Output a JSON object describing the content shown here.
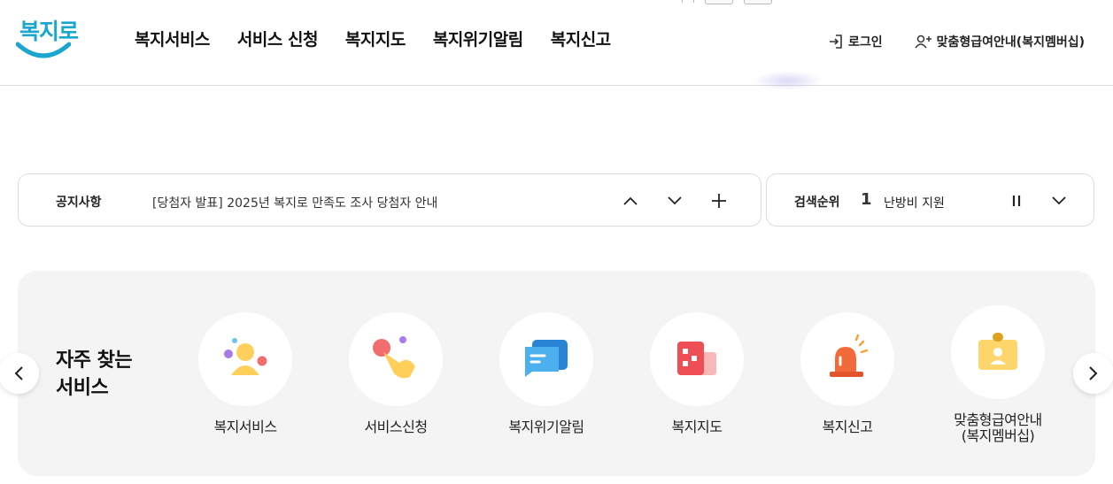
{
  "header": {
    "logo_text": "복지로",
    "nav": [
      "복지서비스",
      "서비스 신청",
      "복지지도",
      "복지위기알림",
      "복지신고"
    ],
    "login_label": "로그인",
    "membership_label": "맞춤형급여안내(복지멤버십)"
  },
  "notice": {
    "title": "공지사항",
    "text": "[당첨자 발표] 2025년 복지로 만족도 조사 당첨자 안내"
  },
  "ranking": {
    "title": "검색순위",
    "rank": "1",
    "keyword": "난방비 지원"
  },
  "frequent": {
    "title_line1": "자주 찾는",
    "title_line2": "서비스",
    "services": [
      {
        "label": "복지서비스",
        "icon": "person-icon"
      },
      {
        "label": "서비스신청",
        "icon": "hand-pointer-icon"
      },
      {
        "label": "복지위기알림",
        "icon": "chat-bubble-icon"
      },
      {
        "label": "복지지도",
        "icon": "map-blocks-icon"
      },
      {
        "label": "복지신고",
        "icon": "siren-icon"
      },
      {
        "label": "맞춤형급여안내\n(복지멤버십)",
        "icon": "id-card-icon"
      }
    ]
  },
  "colors": {
    "brand": "#1aa6cf",
    "panel_bg": "#f4f4f4",
    "border": "#dcdcdc"
  }
}
